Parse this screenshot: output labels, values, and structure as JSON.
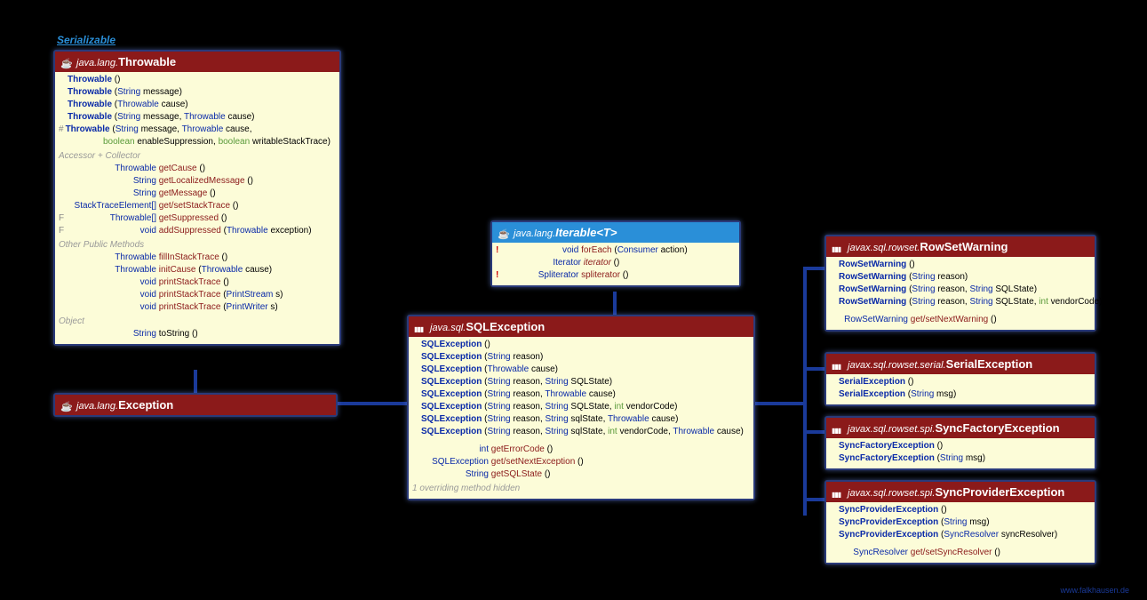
{
  "serializable_label": "Serializable",
  "throwable": {
    "pkg": "java.lang.",
    "cls": "Throwable",
    "ctors": [
      {
        "name": "Throwable",
        "params": ""
      },
      {
        "name": "Throwable",
        "params": [
          [
            "String",
            "message"
          ]
        ]
      },
      {
        "name": "Throwable",
        "params": [
          [
            "Throwable",
            "cause"
          ]
        ]
      },
      {
        "name": "Throwable",
        "params": [
          [
            "String",
            "message"
          ],
          [
            "Throwable",
            "cause"
          ]
        ]
      },
      {
        "name": "Throwable",
        "mod": "#",
        "params": [
          [
            "String",
            "message"
          ],
          [
            "Throwable",
            "cause"
          ]
        ],
        "cont": [
          [
            "boolean",
            "enableSuppression"
          ],
          [
            "boolean",
            "writableStackTrace"
          ]
        ]
      }
    ],
    "section1": "Accessor + Collector",
    "accessors": [
      {
        "rt": "Throwable",
        "name": "getCause",
        "params": ""
      },
      {
        "rt": "String",
        "name": "getLocalizedMessage",
        "params": ""
      },
      {
        "rt": "String",
        "name": "getMessage",
        "params": ""
      },
      {
        "rt": "StackTraceElement[]",
        "name": "get/setStackTrace",
        "params": ""
      },
      {
        "rt": "Throwable[]",
        "name": "getSuppressed",
        "params": "",
        "flag": "F"
      },
      {
        "rt": "void",
        "name": "addSuppressed",
        "params": [
          [
            "Throwable",
            "exception"
          ]
        ],
        "flag": "F"
      }
    ],
    "section2": "Other Public Methods",
    "others": [
      {
        "rt": "Throwable",
        "name": "fillInStackTrace",
        "params": ""
      },
      {
        "rt": "Throwable",
        "name": "initCause",
        "params": [
          [
            "Throwable",
            "cause"
          ]
        ]
      },
      {
        "rt": "void",
        "name": "printStackTrace",
        "params": ""
      },
      {
        "rt": "void",
        "name": "printStackTrace",
        "params": [
          [
            "PrintStream",
            "s"
          ]
        ]
      },
      {
        "rt": "void",
        "name": "printStackTrace",
        "params": [
          [
            "PrintWriter",
            "s"
          ]
        ]
      }
    ],
    "section3": "Object",
    "obj": [
      {
        "rt": "String",
        "name": "toString",
        "params": "",
        "black": true
      }
    ]
  },
  "exception": {
    "pkg": "java.lang.",
    "cls": "Exception"
  },
  "iterable": {
    "pkg": "java.lang.",
    "cls": "Iterable",
    "gen": "<T>",
    "rows": [
      {
        "flag": "!",
        "rt": "void",
        "name": "forEach",
        "params": [
          [
            "Consumer<? super T>",
            "action"
          ]
        ]
      },
      {
        "rt": "Iterator<T>",
        "name": "iterator",
        "params": "",
        "ital": true
      },
      {
        "flag": "!",
        "rt": "Spliterator<T>",
        "name": "spliterator",
        "params": ""
      }
    ]
  },
  "sqlexception": {
    "pkg": "java.sql.",
    "cls": "SQLException",
    "ctors": [
      {
        "name": "SQLException",
        "params": ""
      },
      {
        "name": "SQLException",
        "params": [
          [
            "String",
            "reason"
          ]
        ]
      },
      {
        "name": "SQLException",
        "params": [
          [
            "Throwable",
            "cause"
          ]
        ]
      },
      {
        "name": "SQLException",
        "params": [
          [
            "String",
            "reason"
          ],
          [
            "String",
            "SQLState"
          ]
        ]
      },
      {
        "name": "SQLException",
        "params": [
          [
            "String",
            "reason"
          ],
          [
            "Throwable",
            "cause"
          ]
        ]
      },
      {
        "name": "SQLException",
        "params": [
          [
            "String",
            "reason"
          ],
          [
            "String",
            "SQLState"
          ],
          [
            "int",
            "vendorCode"
          ]
        ]
      },
      {
        "name": "SQLException",
        "params": [
          [
            "String",
            "reason"
          ],
          [
            "String",
            "sqlState"
          ],
          [
            "Throwable",
            "cause"
          ]
        ]
      },
      {
        "name": "SQLException",
        "params": [
          [
            "String",
            "reason"
          ],
          [
            "String",
            "sqlState"
          ],
          [
            "int",
            "vendorCode"
          ],
          [
            "Throwable",
            "cause"
          ]
        ]
      }
    ],
    "methods": [
      {
        "rt": "int",
        "name": "getErrorCode",
        "params": ""
      },
      {
        "rt": "SQLException",
        "name": "get/setNextException",
        "params": ""
      },
      {
        "rt": "String",
        "name": "getSQLState",
        "params": ""
      }
    ],
    "note": "1 overriding method hidden"
  },
  "rowsetwarning": {
    "pkg": "javax.sql.rowset.",
    "cls": "RowSetWarning",
    "ctors": [
      {
        "name": "RowSetWarning",
        "params": ""
      },
      {
        "name": "RowSetWarning",
        "params": [
          [
            "String",
            "reason"
          ]
        ]
      },
      {
        "name": "RowSetWarning",
        "params": [
          [
            "String",
            "reason"
          ],
          [
            "String",
            "SQLState"
          ]
        ]
      },
      {
        "name": "RowSetWarning",
        "params": [
          [
            "String",
            "reason"
          ],
          [
            "String",
            "SQLState"
          ],
          [
            "int",
            "vendorCode"
          ]
        ]
      }
    ],
    "methods": [
      {
        "rt": "RowSetWarning",
        "name": "get/setNextWarning",
        "params": ""
      }
    ]
  },
  "serialexception": {
    "pkg": "javax.sql.rowset.serial.",
    "cls": "SerialException",
    "ctors": [
      {
        "name": "SerialException",
        "params": ""
      },
      {
        "name": "SerialException",
        "params": [
          [
            "String",
            "msg"
          ]
        ]
      }
    ]
  },
  "syncfactoryexception": {
    "pkg": "javax.sql.rowset.spi.",
    "cls": "SyncFactoryException",
    "ctors": [
      {
        "name": "SyncFactoryException",
        "params": ""
      },
      {
        "name": "SyncFactoryException",
        "params": [
          [
            "String",
            "msg"
          ]
        ]
      }
    ]
  },
  "syncproviderexception": {
    "pkg": "javax.sql.rowset.spi.",
    "cls": "SyncProviderException",
    "ctors": [
      {
        "name": "SyncProviderException",
        "params": ""
      },
      {
        "name": "SyncProviderException",
        "params": [
          [
            "String",
            "msg"
          ]
        ]
      },
      {
        "name": "SyncProviderException",
        "params": [
          [
            "SyncResolver",
            "syncResolver"
          ]
        ]
      }
    ],
    "methods": [
      {
        "rt": "SyncResolver",
        "name": "get/setSyncResolver",
        "params": ""
      }
    ]
  },
  "footer": "www.falkhausen.de"
}
